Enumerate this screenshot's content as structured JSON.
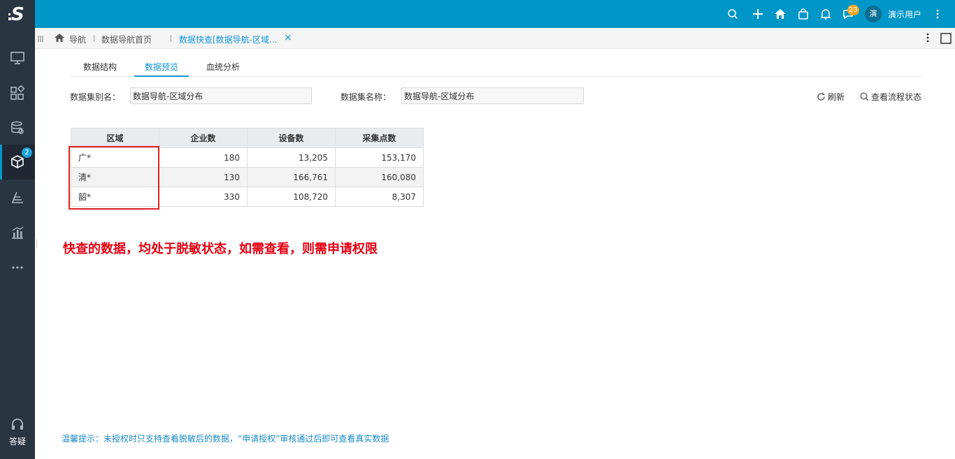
{
  "header": {
    "notification_count": "23",
    "avatar_initial": "演",
    "username": "演示用户"
  },
  "sidebar": {
    "badge_count": "2",
    "bottom_label": "答疑"
  },
  "tabbar": {
    "home_label": "导航",
    "tab1_label": "数据导航首页",
    "tab2_label": "数据快查[数据导航-区域...",
    "close_glyph": "×"
  },
  "subtabs": [
    "数据结构",
    "数据预览",
    "血统分析"
  ],
  "form": {
    "alias_label": "数据集别名：",
    "alias_value": "数据导航-区域分布",
    "name_label": "数据集名称：",
    "name_value": "数据导航-区域分布",
    "refresh_label": "刷新",
    "flow_label": "查看流程状态"
  },
  "table": {
    "headers": [
      "区域",
      "企业数",
      "设备数",
      "采集点数"
    ],
    "rows": [
      [
        "广*",
        "180",
        "13,205",
        "153,170"
      ],
      [
        "清*",
        "130",
        "166,761",
        "160,080"
      ],
      [
        "韶*",
        "330",
        "108,720",
        "8,307"
      ]
    ]
  },
  "annotation": "快查的数据，均处于脱敏状态，如需查看，则需申请权限",
  "tip": "温馨提示：未授权时只支持查看脱敏后的数据，“申请授权”审核通过后即可查看真实数据",
  "colors": {
    "header": "#0096c8",
    "sidebar": "#2a3542",
    "accent": "#1296db",
    "annotation": "#e60012"
  }
}
